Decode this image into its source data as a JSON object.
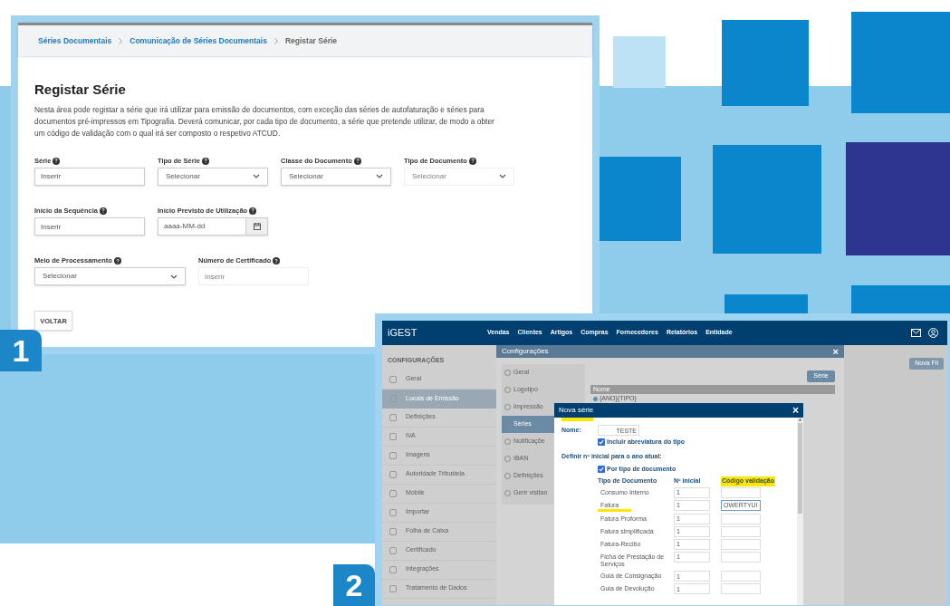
{
  "screenshot_1": {
    "badge": "1",
    "breadcrumb": [
      {
        "label": "Séries Documentais",
        "kind": "link"
      },
      {
        "label": "Comunicação de Séries Documentais",
        "kind": "link"
      },
      {
        "label": "Registar Série",
        "kind": "current"
      }
    ],
    "title": "Registar Série",
    "description": "Nesta área pode registar a série que irá utilizar para emissão de documentos, com exceção das séries de autofaturação e séries para documentos pré-impressos em Tipografia. Deverá comunicar, por cada tipo de documento, a série que pretende utilizar, de modo a obter um código de validação com o qual irá ser composto o respetivo ATCUD.",
    "field_rows": [
      [
        {
          "label": "Série",
          "kind": "input",
          "placeholder": "Inserir",
          "disabled": false
        },
        {
          "label": "Tipo de Série",
          "kind": "select",
          "value": "Selecionar",
          "disabled": false
        },
        {
          "label": "Classe do Documento",
          "kind": "select",
          "value": "Selecionar",
          "disabled": false
        },
        {
          "label": "Tipo de Documento",
          "kind": "select",
          "value": "Selecionar",
          "disabled": true
        }
      ],
      [
        {
          "label": "Início da Sequência",
          "kind": "input",
          "placeholder": "Inserir",
          "disabled": false
        },
        {
          "label": "Início Previsto de Utilização",
          "kind": "date",
          "placeholder": "aaaa-MM-dd",
          "disabled": false
        }
      ],
      [
        {
          "label": "Meio de Processamento",
          "kind": "select",
          "value": "Selecionar",
          "disabled": false,
          "wide": true
        },
        {
          "label": "Número de Certificado",
          "kind": "input",
          "placeholder": "Inserir",
          "disabled": true
        }
      ]
    ],
    "back_button": "VOLTAR"
  },
  "screenshot_2": {
    "badge": "2",
    "logo": "iGEST",
    "nav": [
      "Vendas",
      "Clientes",
      "Artigos",
      "Compras",
      "Fornecedores",
      "Relatórios",
      "Entidade"
    ],
    "sidebar": {
      "heading": "CONFIGURAÇÕES",
      "items": [
        {
          "label": "Geral",
          "selected": false
        },
        {
          "label": "Locais de Emissão",
          "selected": true
        },
        {
          "label": "Definições",
          "selected": false
        },
        {
          "label": "IVA",
          "selected": false
        },
        {
          "label": "Imagens",
          "selected": false
        },
        {
          "label": "Autoridade Tributária",
          "selected": false
        },
        {
          "label": "Mobile",
          "selected": false
        },
        {
          "label": "Importar",
          "selected": false
        },
        {
          "label": "Folha de Caixa",
          "selected": false
        },
        {
          "label": "Certificado",
          "selected": false
        },
        {
          "label": "Integrações",
          "selected": false
        },
        {
          "label": "Tratamento de Dados",
          "selected": false
        }
      ]
    },
    "background_button": "Nova Fil",
    "config_dialog": {
      "title": "Configurações",
      "close": "×",
      "menu": [
        {
          "label": "Geral",
          "selected": false
        },
        {
          "label": "Logotipo",
          "selected": false
        },
        {
          "label": "Impressão",
          "selected": false
        },
        {
          "label": "Séries",
          "selected": true
        },
        {
          "label": "Notificaçõe",
          "selected": false
        },
        {
          "label": "IBAN",
          "selected": false
        },
        {
          "label": "Definições",
          "selected": false
        },
        {
          "label": "Gerir visitan",
          "selected": false
        }
      ],
      "button": "Série",
      "table_header": "Nome",
      "table_row": "{ANO}{TIPO}"
    },
    "series_dialog": {
      "title": "Nova série",
      "close": "×",
      "name_label": "Nome:",
      "name_value": "TESTE",
      "include_abbrev": {
        "label": "Incluir abreviatura do tipo",
        "checked": true
      },
      "section_label": "Definir nº inicial para o ano atual:",
      "by_type": {
        "label": "Por tipo de documento",
        "checked": true
      },
      "columns": [
        {
          "label": "Tipo de Documento",
          "highlighted": false
        },
        {
          "label": "Nº inicial",
          "highlighted": false
        },
        {
          "label": "Código validação",
          "highlighted": true
        }
      ],
      "rows": [
        {
          "type": "Consumo Interno",
          "initial": "1",
          "code": "",
          "highlighted": false
        },
        {
          "type": "Fatura",
          "initial": "1",
          "code": "QWERTYUI",
          "highlighted": true
        },
        {
          "type": "Fatura Proforma",
          "initial": "1",
          "code": "",
          "highlighted": false
        },
        {
          "type": "Fatura simplificada",
          "initial": "1",
          "code": "",
          "highlighted": false
        },
        {
          "type": "Fatura-Recibo",
          "initial": "1",
          "code": "",
          "highlighted": false
        },
        {
          "type": "Ficha de Prestação de Serviços",
          "initial": "1",
          "code": "",
          "highlighted": false
        },
        {
          "type": "Guia de Consignação",
          "initial": "1",
          "code": "",
          "highlighted": false
        },
        {
          "type": "Guia de Devolução",
          "initial": "1",
          "code": "",
          "highlighted": false
        }
      ]
    }
  }
}
